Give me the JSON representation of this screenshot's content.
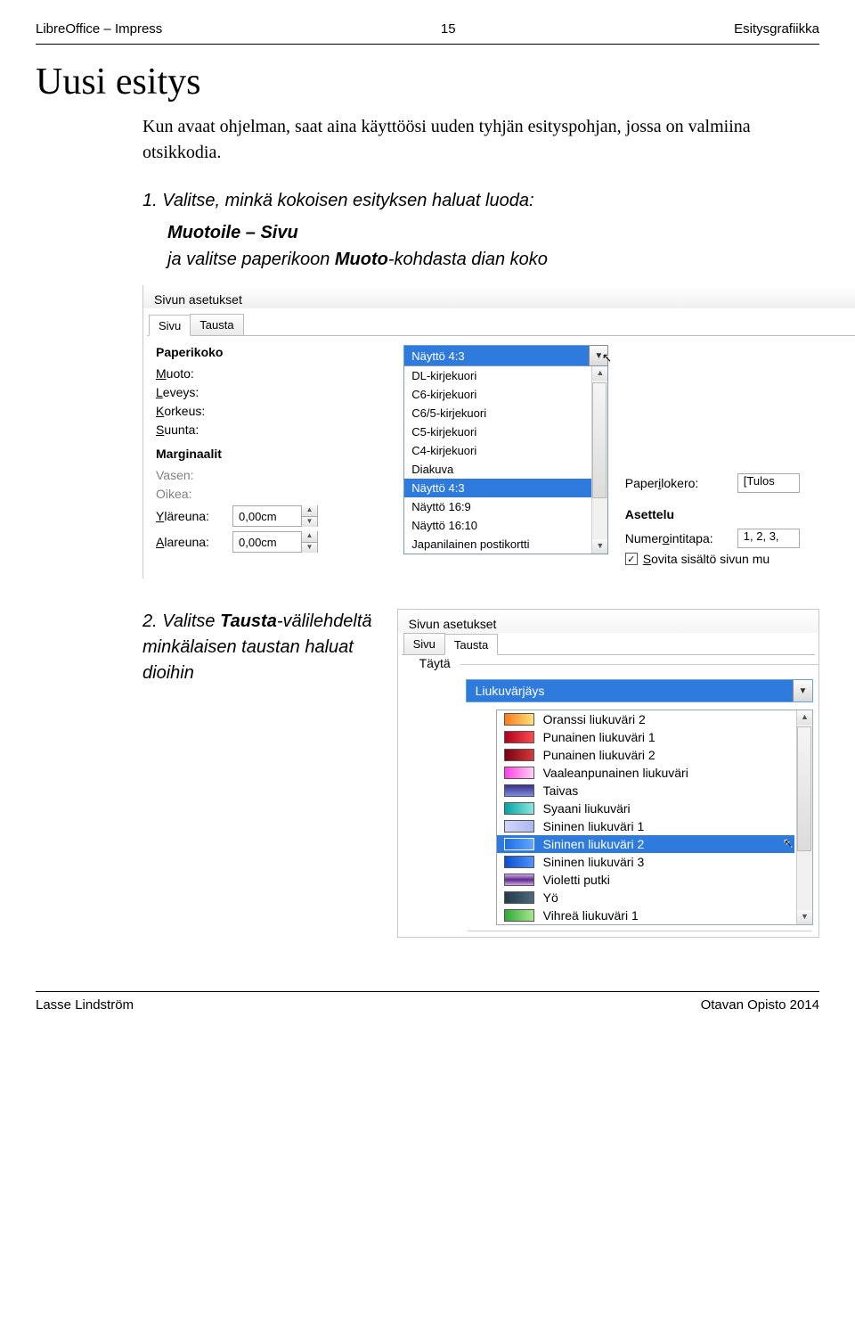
{
  "header": {
    "left": "LibreOffice – Impress",
    "center": "15",
    "right": "Esitysgrafiikka"
  },
  "title": "Uusi esitys",
  "intro": "Kun avaat ohjelman, saat aina käyttöösi uuden tyhjän esityspohjan, jossa on valmiina otsikkodia.",
  "step1": {
    "prefix": "1. Valitse, minkä kokoisen esityksen haluat luoda:",
    "bold1": "Muotoile – Sivu",
    "line2a": "ja valitse paperikoon ",
    "bold2": "Muoto",
    "line2b": "-kohdasta dian koko"
  },
  "dlg1": {
    "title": "Sivun asetukset",
    "tab_sivu": "Sivu",
    "tab_tausta": "Tausta",
    "grp_paperikoko": "Paperikoko",
    "lbl_muoto_p": "M",
    "lbl_muoto_r": "uoto:",
    "lbl_leveys_p": "L",
    "lbl_leveys_r": "eveys:",
    "lbl_korkeus_p": "K",
    "lbl_korkeus_r": "orkeus:",
    "lbl_suunta_p": "S",
    "lbl_suunta_r": "uunta:",
    "grp_marginaalit": "Marginaalit",
    "opts": [
      "DL-kirjekuori",
      "C6-kirjekuori",
      "C6/5-kirjekuori",
      "C5-kirjekuori",
      "C4-kirjekuori",
      "Diakuva",
      "Näyttö 4:3",
      "Näyttö 16:9",
      "Näyttö 16:10",
      "Japanilainen postikortti"
    ],
    "sel_opt": "Näyttö 4:3",
    "lbl_vasen": "Vasen:",
    "lbl_oikea": "Oikea:",
    "lbl_yla_p": "Y",
    "lbl_yla_r": "läreuna:",
    "lbl_ala_p": "A",
    "lbl_ala_r": "lareuna:",
    "val_yla": "0,00cm",
    "val_ala": "0,00cm",
    "lbl_papl_a": "Paper",
    "lbl_papl_u": "i",
    "lbl_papl_b": "lokero:",
    "val_papl": "[Tulos",
    "grp_asettelu": "Asettelu",
    "lbl_num_a": "Numer",
    "lbl_num_u": "o",
    "lbl_num_b": "intitapa:",
    "val_num": "1, 2, 3,",
    "lbl_sov_u": "S",
    "lbl_sov_r": "ovita sisältö sivun mu"
  },
  "step2": {
    "prefix": "2. Valitse ",
    "bold1": "Tausta",
    "rest": "-välilehdeltä minkälaisen taustan haluat dioihin"
  },
  "dlg2": {
    "title": "Sivun asetukset",
    "tab_sivu": "Sivu",
    "tab_tausta": "Tausta",
    "grp_tayta": "Täytä",
    "sel_fill": "Liukuvärjäys",
    "fills": [
      {
        "name": "Oranssi liukuväri 2",
        "sw": "linear-gradient(90deg,#ff7a1a,#ffe277)"
      },
      {
        "name": "Punainen liukuväri 1",
        "sw": "linear-gradient(90deg,#b00020,#ff4a4a)"
      },
      {
        "name": "Punainen liukuväri 2",
        "sw": "linear-gradient(90deg,#7a0012,#d63a3a)"
      },
      {
        "name": "Vaaleanpunainen liukuväri",
        "sw": "linear-gradient(90deg,#ff3ee6,#ffd1f5)"
      },
      {
        "name": "Taivas",
        "sw": "linear-gradient(180deg,#3a2f8a,#7a8de0)"
      },
      {
        "name": "Syaani liukuväri",
        "sw": "linear-gradient(90deg,#00a5a5,#8be8e0)"
      },
      {
        "name": "Sininen liukuväri 1",
        "sw": "linear-gradient(90deg,#cfd6ff,#aeb8f0)"
      },
      {
        "name": "Sininen liukuväri 2",
        "sw": "linear-gradient(90deg,#1a6ee6,#63a6ff)"
      },
      {
        "name": "Sininen liukuväri 3",
        "sw": "linear-gradient(90deg,#0b4fd0,#4f92ff)"
      },
      {
        "name": "Violetti putki",
        "sw": "linear-gradient(180deg,#d0a7e6,#5a2a8a,#d0a7e6)"
      },
      {
        "name": "Yö",
        "sw": "linear-gradient(90deg,#243a4a,#4a6a7a)"
      },
      {
        "name": "Vihreä liukuväri 1",
        "sw": "linear-gradient(90deg,#2fa83a,#a6e88a)"
      }
    ],
    "sel_index": 7
  },
  "footer": {
    "left": "Lasse Lindström",
    "right": "Otavan Opisto 2014"
  }
}
